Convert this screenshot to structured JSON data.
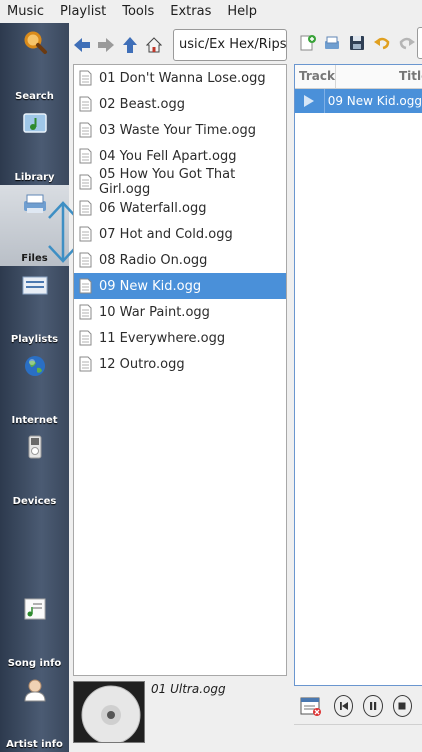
{
  "menubar": [
    "Music",
    "Playlist",
    "Tools",
    "Extras",
    "Help"
  ],
  "sidebar": {
    "items": [
      {
        "label": "Search",
        "icon": "magnifier-icon"
      },
      {
        "label": "Library",
        "icon": "music-library-icon"
      },
      {
        "label": "Files",
        "icon": "files-icon"
      },
      {
        "label": "Playlists",
        "icon": "playlist-icon"
      },
      {
        "label": "Internet",
        "icon": "globe-icon"
      },
      {
        "label": "Devices",
        "icon": "ipod-icon"
      },
      {
        "label": "Song info",
        "icon": "song-info-icon"
      },
      {
        "label": "Artist info",
        "icon": "artist-icon"
      }
    ],
    "active": "Files",
    "accent": "#3e8fc4"
  },
  "filebrowser": {
    "path": "usic/Ex Hex/Rips",
    "files": [
      "01 Don't Wanna Lose.ogg",
      "02 Beast.ogg",
      "03 Waste Your Time.ogg",
      "04 You Fell Apart.ogg",
      "05 How You Got That Girl.ogg",
      "06 Waterfall.ogg",
      "07 Hot and Cold.ogg",
      "08 Radio On.ogg",
      "09 New Kid.ogg",
      "10 War Paint.ogg",
      "11 Everywhere.ogg",
      "12 Outro.ogg"
    ],
    "selected_index": 8,
    "selection_color": "#4a90d9"
  },
  "nowplaying": {
    "title": "01 Ultra.ogg"
  },
  "playlist": {
    "columns": {
      "track": "Track",
      "title": "Title"
    },
    "rows": [
      {
        "title": "09 New Kid.ogg",
        "playing": true
      }
    ]
  }
}
